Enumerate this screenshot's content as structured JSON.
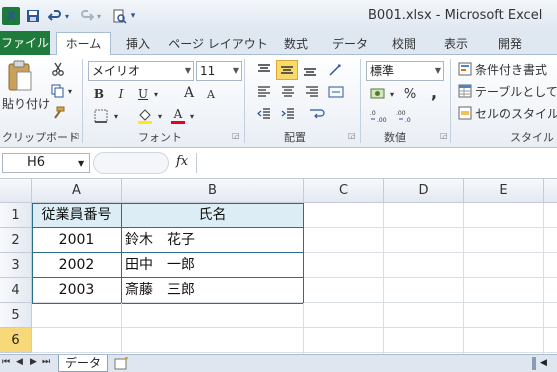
{
  "window": {
    "title": "B001.xlsx - Microsoft Excel"
  },
  "quick_access": {
    "logo": "X",
    "save_icon": "save-icon",
    "undo_icon": "undo-icon",
    "redo_icon": "redo-icon",
    "preview_icon": "print-preview-icon"
  },
  "tabs": {
    "file": "ファイル",
    "home": "ホーム",
    "insert": "挿入",
    "page_layout": "ページ レイアウト",
    "formulas": "数式",
    "data": "データ",
    "review": "校閲",
    "view": "表示",
    "developer": "開発"
  },
  "ribbon": {
    "clipboard": {
      "paste": "貼り付け",
      "label": "クリップボード"
    },
    "font": {
      "name": "メイリオ",
      "size": "11",
      "bold": "B",
      "italic": "I",
      "underline": "U",
      "grow": "A",
      "shrink": "A",
      "color_letter": "A",
      "label": "フォント",
      "font_color": "#e8001c"
    },
    "alignment": {
      "label": "配置"
    },
    "number": {
      "format": "標準",
      "percent": "%",
      "comma": ",",
      "label": "数値"
    },
    "styles": {
      "conditional": "条件付き書式",
      "table": "テーブルとして書式",
      "cell_styles": "セルのスタイル",
      "label": "スタイル"
    }
  },
  "formula_bar": {
    "name_box": "H6",
    "fx": "fx",
    "content": ""
  },
  "grid": {
    "columns": [
      "A",
      "B",
      "C",
      "D",
      "E"
    ],
    "rows": [
      "1",
      "2",
      "3",
      "4",
      "5",
      "6"
    ],
    "selected_row": "6",
    "table": {
      "header": [
        "従業員番号",
        "氏名"
      ],
      "rows": [
        [
          "2001",
          "鈴木　花子"
        ],
        [
          "2002",
          "田中　一郎"
        ],
        [
          "2003",
          "斎藤　三郎"
        ]
      ]
    }
  },
  "sheet_tabs": {
    "active": "データ",
    "nav": [
      "⏮",
      "◀",
      "▶",
      "⏭"
    ]
  },
  "colors": {
    "accent_green": "#1e7b3c",
    "header_fill": "#dcedf5",
    "table_border": "#2e6e8a",
    "selected_header": "#f7d97a"
  }
}
